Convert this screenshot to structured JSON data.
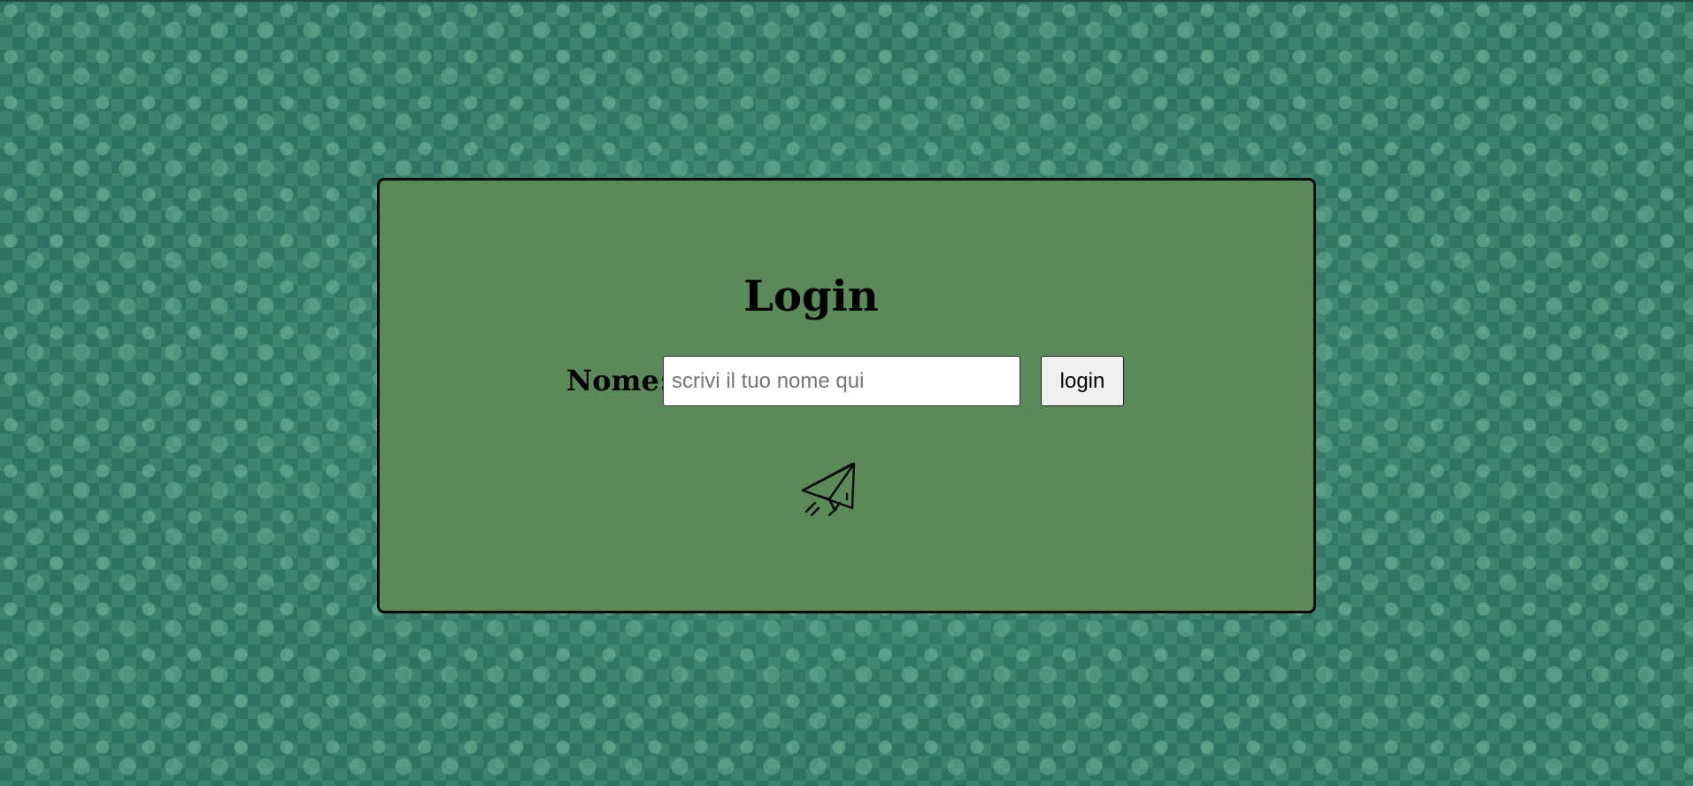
{
  "login_card": {
    "title": "Login",
    "name_label": "Nome:",
    "name_input": {
      "value": "",
      "placeholder": "scrivi il tuo nome qui"
    },
    "login_button_label": "login",
    "icon": "paper-plane-icon"
  },
  "colors": {
    "background": "#2f7462",
    "card_background": "#5a8a57",
    "card_border": "#0b0b0b"
  }
}
